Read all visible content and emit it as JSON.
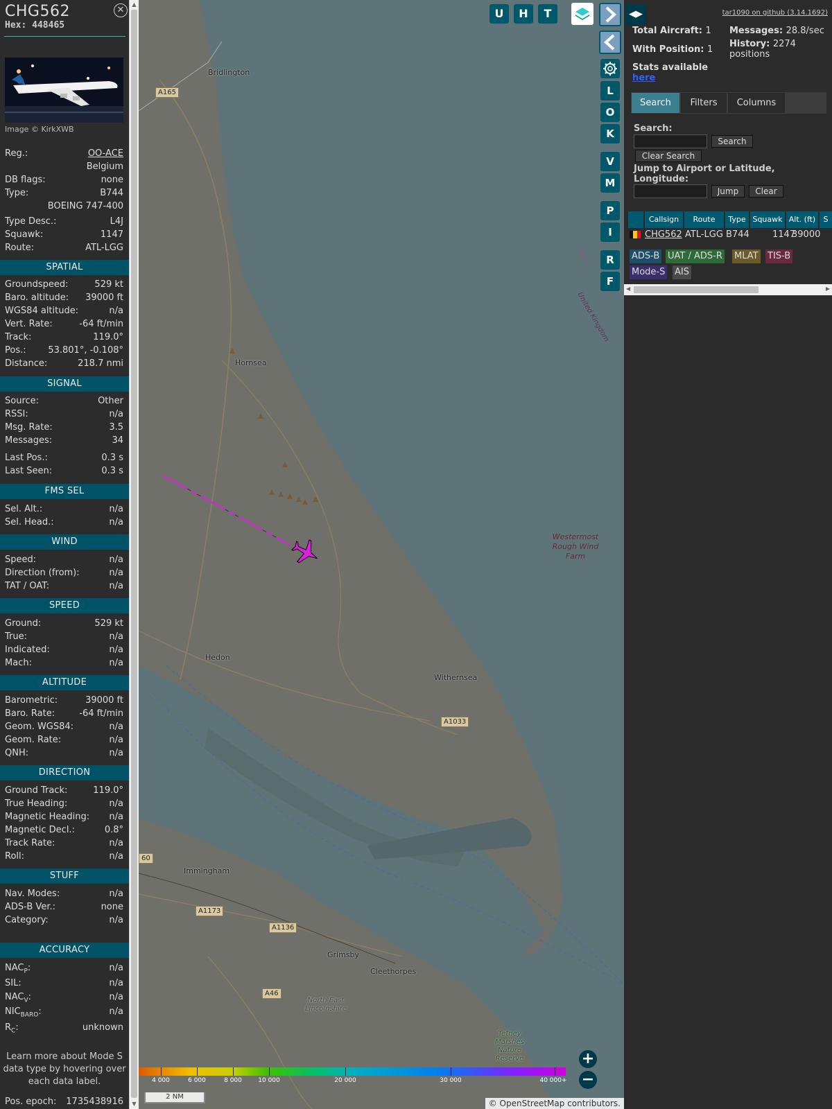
{
  "aircraft": {
    "callsign": "CHG562",
    "hex_label": "Hex:",
    "hex": "448465",
    "image_credit": "Image © KirkXWB"
  },
  "info_rows": [
    {
      "key": "Reg.:",
      "value": "OO-ACE",
      "link": true
    },
    {
      "key": "",
      "value": "Belgium"
    },
    {
      "key": "DB flags:",
      "value": "none"
    },
    {
      "key": "Type:",
      "value": "B744"
    },
    {
      "key": "",
      "value": "BOEING 747-400"
    },
    {
      "key": "Type Desc.:",
      "value": "L4J"
    },
    {
      "key": "Squawk:",
      "value": "1147"
    },
    {
      "key": "Route:",
      "value": "ATL-LGG"
    }
  ],
  "sections": {
    "spatial": "SPATIAL",
    "signal": "SIGNAL",
    "fms_sel": "FMS SEL",
    "wind": "WIND",
    "speed": "SPEED",
    "altitude": "ALTITUDE",
    "direction": "DIRECTION",
    "stuff": "STUFF",
    "accuracy": "ACCURACY"
  },
  "spatial": [
    {
      "key": "Groundspeed:",
      "value": "529 kt"
    },
    {
      "key": "Baro. altitude:",
      "value": "39000 ft"
    },
    {
      "key": "WGS84 altitude:",
      "value": "n/a"
    },
    {
      "key": "Vert. Rate:",
      "value": "-64 ft/min"
    },
    {
      "key": "Track:",
      "value": "119.0°"
    },
    {
      "key": "Pos.:",
      "value": "53.801°, -0.108°"
    },
    {
      "key": "Distance:",
      "value": "218.7 nmi"
    }
  ],
  "signal": [
    {
      "key": "Source:",
      "value": "Other"
    },
    {
      "key": "RSSI:",
      "value": "n/a"
    },
    {
      "key": "Msg. Rate:",
      "value": "3.5"
    },
    {
      "key": "Messages:",
      "value": "34"
    },
    {
      "key": "Last Pos.:",
      "value": "0.3 s"
    },
    {
      "key": "Last Seen:",
      "value": "0.3 s"
    }
  ],
  "fms_sel": [
    {
      "key": "Sel. Alt.:",
      "value": "n/a"
    },
    {
      "key": "Sel. Head.:",
      "value": "n/a"
    }
  ],
  "wind": [
    {
      "key": "Speed:",
      "value": "n/a"
    },
    {
      "key": "Direction (from):",
      "value": "n/a"
    },
    {
      "key": "TAT / OAT:",
      "value": "n/a"
    }
  ],
  "speed": [
    {
      "key": "Ground:",
      "value": "529 kt"
    },
    {
      "key": "True:",
      "value": "n/a"
    },
    {
      "key": "Indicated:",
      "value": "n/a"
    },
    {
      "key": "Mach:",
      "value": "n/a"
    }
  ],
  "altitude": [
    {
      "key": "Barometric:",
      "value": "39000 ft"
    },
    {
      "key": "Baro. Rate:",
      "value": "-64 ft/min"
    },
    {
      "key": "Geom. WGS84:",
      "value": "n/a"
    },
    {
      "key": "Geom. Rate:",
      "value": "n/a"
    },
    {
      "key": "QNH:",
      "value": "n/a"
    }
  ],
  "direction": [
    {
      "key": "Ground Track:",
      "value": "119.0°"
    },
    {
      "key": "True Heading:",
      "value": "n/a"
    },
    {
      "key": "Magnetic Heading:",
      "value": "n/a"
    },
    {
      "key": "Magnetic Decl.:",
      "value": "0.8°"
    },
    {
      "key": "Track Rate:",
      "value": "n/a"
    },
    {
      "key": "Roll:",
      "value": "n/a"
    }
  ],
  "stuff": [
    {
      "key": "Nav. Modes:",
      "value": "n/a"
    },
    {
      "key": "ADS-B Ver.:",
      "value": "none"
    },
    {
      "key": "Category:",
      "value": "n/a"
    }
  ],
  "accuracy": [
    {
      "key": "NAC",
      "sub": "P",
      "tail": ":",
      "value": "n/a"
    },
    {
      "key": "SIL:",
      "value": "n/a"
    },
    {
      "key": "NAC",
      "sub": "V",
      "tail": ":",
      "value": "n/a"
    },
    {
      "key": "NIC",
      "sub": "BARO",
      "tail": ":",
      "value": "n/a"
    },
    {
      "key": "R",
      "sub": "C",
      "tail": ":",
      "value": "unknown"
    }
  ],
  "learn_more": "Learn more about Mode S data type by hovering over each data label.",
  "pos_epoch": {
    "key": "Pos. epoch:",
    "value": "1735438916"
  },
  "map": {
    "top_buttons": [
      "U",
      "H",
      "T"
    ],
    "side_buttons": [
      "L",
      "O",
      "K",
      "V",
      "M",
      "P",
      "I",
      "R",
      "F"
    ],
    "towns": [
      "Bridlington",
      "Hornsea",
      "Hedon",
      "Withernsea",
      "Immingham",
      "Grimsby",
      "Cleethorpes",
      "North East Lincolnshire",
      "Tetney Marshes Nature Reserve"
    ],
    "roads": [
      "A165",
      "A1033",
      "A1173",
      "A1136",
      "A46",
      "60"
    ],
    "windfarm": "Westermost Rough Wind Farm",
    "border_label": "United Kingdom",
    "altitude_scale": [
      "4 000",
      "6 000",
      "8 000",
      "10 000",
      "20 000",
      "30 000",
      "40 000+"
    ],
    "scale_bar": "2 NM",
    "attribution_prefix": "© ",
    "attribution_link": "OpenStreetMap",
    "attribution_suffix": " contributors.",
    "zoom_in": "+",
    "zoom_out": "−",
    "aircraft_color": "#e01ee0"
  },
  "right": {
    "github": "tar1090 on github (3.14.1692)",
    "total_aircraft_label": "Total Aircraft:",
    "total_aircraft": "1",
    "with_position_label": "With Position:",
    "with_position": "1",
    "messages_label": "Messages:",
    "messages": "28.8/sec",
    "history_label": "History:",
    "history": "2274 positions",
    "stats_label": "Stats available",
    "stats_link": "here",
    "tabs": [
      "Search",
      "Filters",
      "Columns"
    ],
    "search_label": "Search:",
    "search_button": "Search",
    "clear_search_button": "Clear Search",
    "jump_label": "Jump to Airport or Latitude, Longitude:",
    "jump_button": "Jump",
    "clear_button": "Clear",
    "table_headers": [
      "Callsign",
      "Route",
      "Type",
      "Squawk",
      "Alt. (ft)",
      "S"
    ],
    "table_row": {
      "callsign": "CHG562",
      "route": "ATL-LGG",
      "type": "B744",
      "squawk": "1147",
      "alt": "39000"
    },
    "sources": [
      {
        "label": "ADS-B",
        "color": "#1f4e6b"
      },
      {
        "label": "UAT / ADS-R",
        "color": "#2f6b3a"
      },
      {
        "label": "MLAT",
        "color": "#6b5a2a"
      },
      {
        "label": "TIS-B",
        "color": "#6b2a3e"
      },
      {
        "label": "Mode-S",
        "color": "#3a2f6b"
      },
      {
        "label": "AIS",
        "color": "#4a4a4a"
      }
    ]
  }
}
